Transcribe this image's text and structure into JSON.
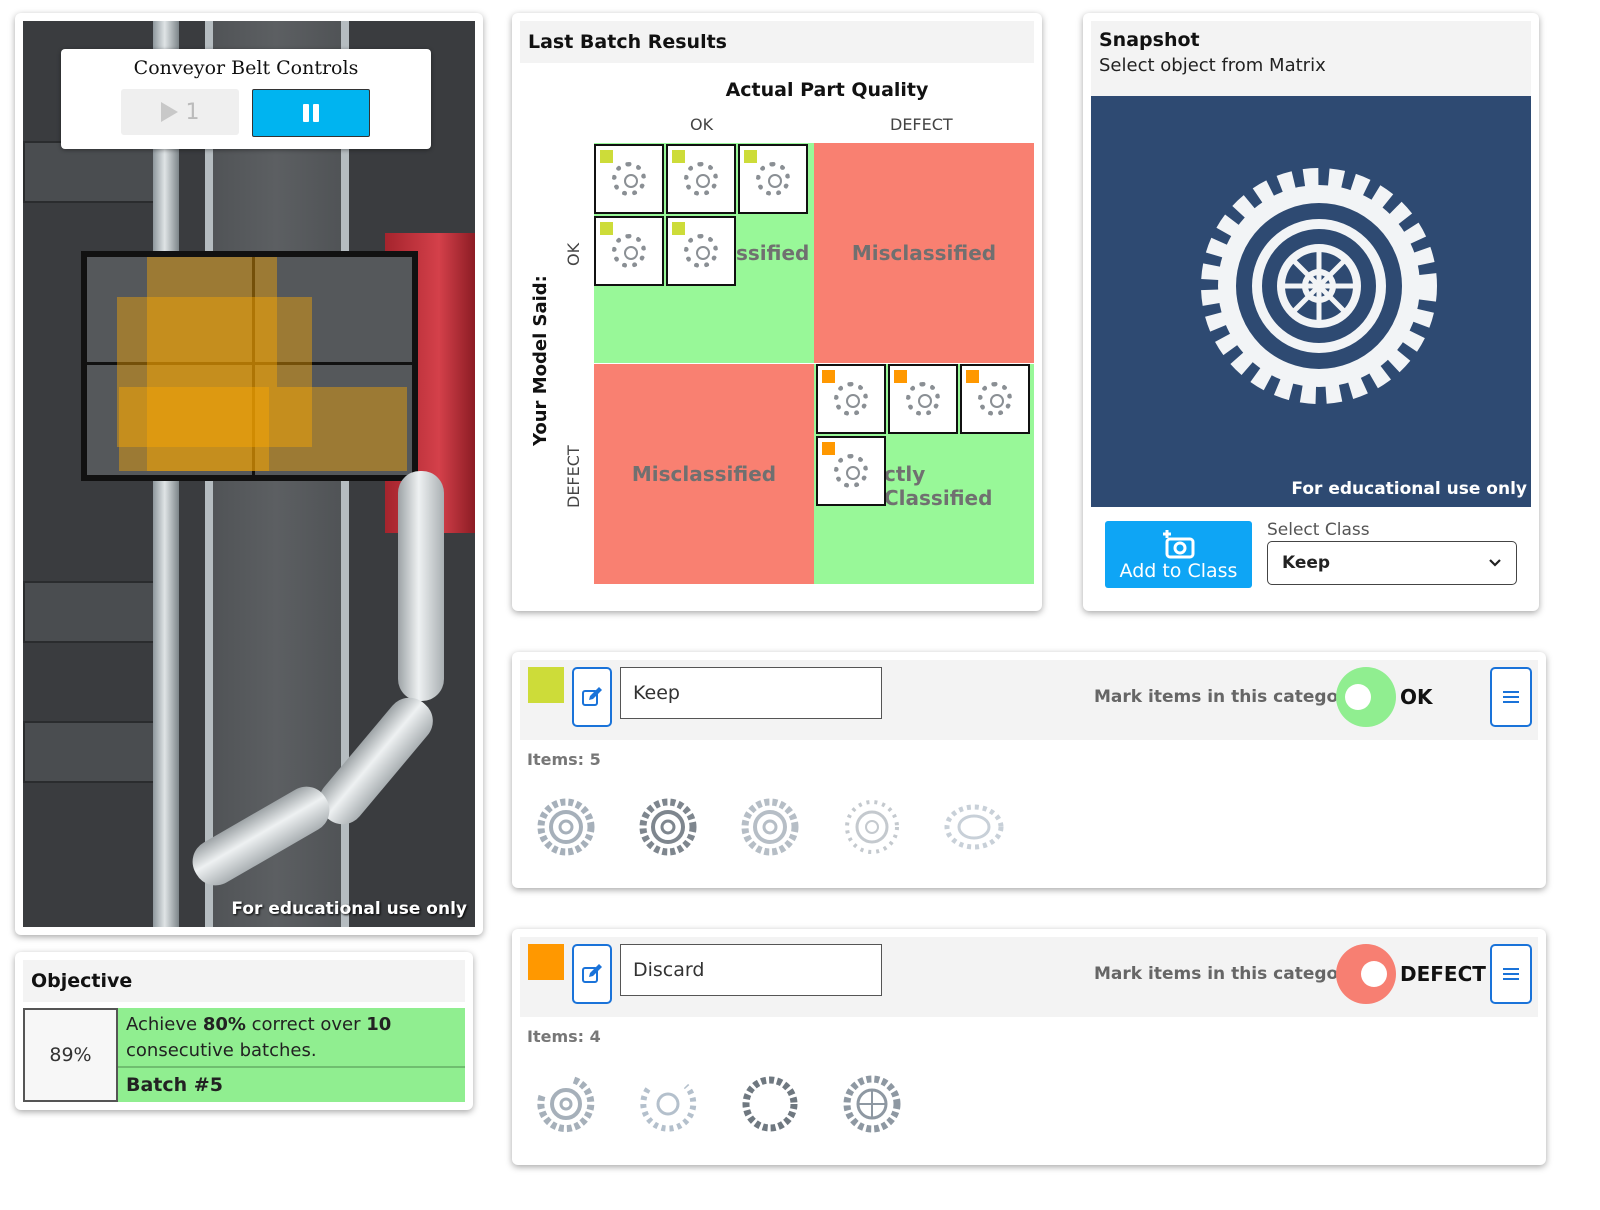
{
  "sim": {
    "watermark": "For educational use only",
    "controls": {
      "title": "Conveyor Belt Controls",
      "play_label": "1"
    }
  },
  "objective": {
    "title": "Objective",
    "percent": "89%",
    "text_prefix": "Achieve ",
    "target_pct": "80%",
    "text_middle": " correct over ",
    "target_batches": "10",
    "text_suffix": " consecutive batches.",
    "batch": "Batch #5"
  },
  "results": {
    "title": "Last Batch Results",
    "matrix_title": "Actual Part Quality",
    "col_ok": "OK",
    "col_defect": "DEFECT",
    "row_axis": "Your Model Said:",
    "row_ok": "OK",
    "row_defect": "DEFECT",
    "cell_ok_ok": "ssified",
    "cell_ok_defect": "Misclassified",
    "cell_defect_ok": "Misclassified",
    "cell_defect_defect": "ctly Classified",
    "tag_colors": {
      "keep": "#cddc39",
      "discard": "#ff9800"
    }
  },
  "snapshot": {
    "title": "Snapshot",
    "subtitle": "Select object from Matrix",
    "watermark": "For educational use only",
    "add_button": "Add to Class",
    "select_label": "Select Class",
    "select_value": "Keep"
  },
  "categories": [
    {
      "name": "Keep",
      "color": "#cddc39",
      "mark_label": "Mark items in this category:",
      "toggle_label": "OK",
      "toggle_color": "#90ee90",
      "items_label": "Items: 5"
    },
    {
      "name": "Discard",
      "color": "#ff9800",
      "mark_label": "Mark items in this category:",
      "toggle_label": "DEFECT",
      "toggle_color": "#f77f72",
      "items_label": "Items: 4"
    }
  ]
}
